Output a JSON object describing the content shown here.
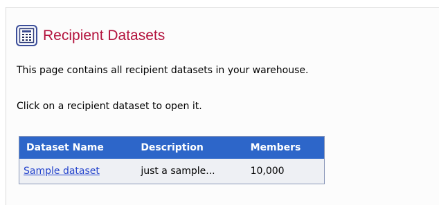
{
  "page": {
    "title": "Recipient Datasets",
    "icon": "dataset-grid-icon",
    "intro": "This page contains all recipient datasets in your warehouse.",
    "hint": "Click on a recipient dataset to open it."
  },
  "table": {
    "columns": [
      "Dataset Name",
      "Description",
      "Members"
    ],
    "rows": [
      {
        "name": "Sample dataset",
        "description": "just a sample...",
        "members": "10,000"
      }
    ]
  },
  "colors": {
    "title": "#b3123d",
    "header_bg": "#2d66c9",
    "link": "#2242cc",
    "row_bg": "#eef0f4"
  }
}
